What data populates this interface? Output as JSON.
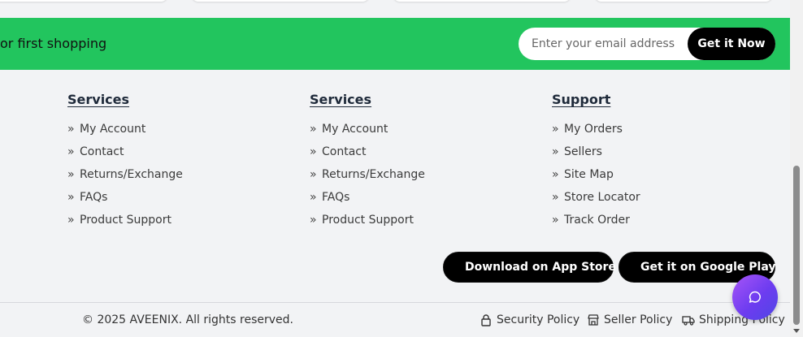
{
  "banner": {
    "text": "or first shopping",
    "email_placeholder": "Enter your email address",
    "button_label": "Get it Now",
    "bg_color": "#22c55e"
  },
  "footer_columns": [
    {
      "heading": "Services",
      "items": [
        "My Account",
        "Contact",
        "Returns/Exchange",
        "FAQs",
        "Product Support"
      ]
    },
    {
      "heading": "Services",
      "items": [
        "My Account",
        "Contact",
        "Returns/Exchange",
        "FAQs",
        "Product Support"
      ]
    },
    {
      "heading": "Support",
      "items": [
        "My Orders",
        "Sellers",
        "Site Map",
        "Store Locator",
        "Track Order"
      ]
    }
  ],
  "bullet_glyph": "»",
  "app_buttons": {
    "app_store": {
      "label": "Download on App Store",
      "icon": "apple-icon"
    },
    "google_play": {
      "label": "Get it on Google Play",
      "icon": "play-icon"
    }
  },
  "bottom_bar": {
    "copyright": "© 2025 AVEENIX. All rights reserved.",
    "policies": [
      {
        "label": "Security Policy",
        "icon": "lock-icon"
      },
      {
        "label": "Seller Policy",
        "icon": "store-icon"
      },
      {
        "label": "Shipping Policy",
        "icon": "truck-icon"
      }
    ]
  },
  "chat_button": {
    "icon": "chat-bubble-icon",
    "accent": "#7c3aed"
  }
}
